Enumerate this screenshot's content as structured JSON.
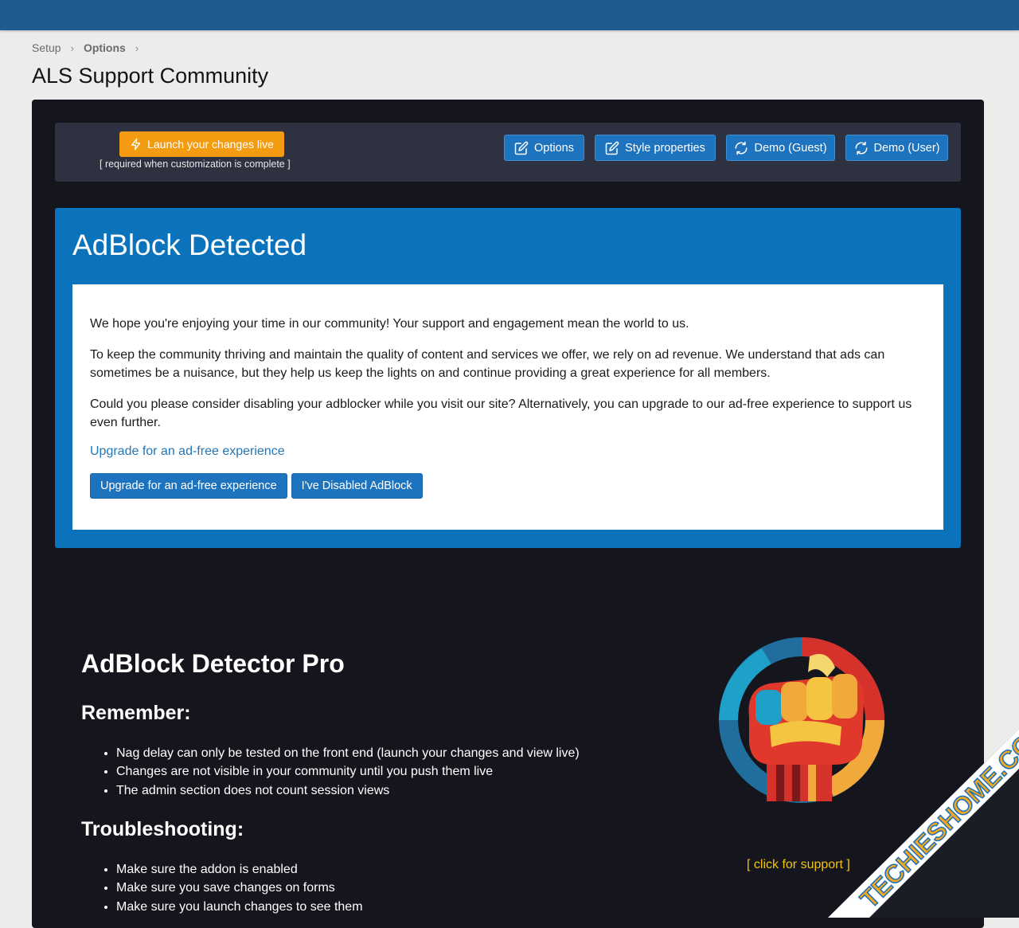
{
  "breadcrumb": {
    "items": [
      "Setup",
      "Options"
    ]
  },
  "page": {
    "title": "ALS Support Community"
  },
  "toolbar": {
    "launch_label": "Launch your changes live",
    "launch_note": "[ required when customization is complete ]",
    "buttons": [
      {
        "label": "Options",
        "icon": "edit-icon"
      },
      {
        "label": "Style properties",
        "icon": "edit-icon"
      },
      {
        "label": "Demo (Guest)",
        "icon": "refresh-icon"
      },
      {
        "label": "Demo (User)",
        "icon": "refresh-icon"
      }
    ]
  },
  "adblock": {
    "title": "AdBlock Detected",
    "paragraphs": [
      "We hope you're enjoying your time in our community! Your support and engagement mean the world to us.",
      "To keep the community thriving and maintain the quality of content and services we offer, we rely on ad revenue. We understand that ads can sometimes be a nuisance, but they help us keep the lights on and continue providing a great experience for all members.",
      "Could you please consider disabling your adblocker while you visit our site? Alternatively, you can upgrade to our ad-free experience to support us even further."
    ],
    "link_text": "Upgrade for an ad-free experience",
    "upgrade_button": "Upgrade for an ad-free experience",
    "disabled_button": "I've Disabled AdBlock"
  },
  "pro": {
    "title": "AdBlock Detector Pro",
    "remember_heading": "Remember:",
    "remember_items": [
      "Nag delay can only be tested on the front end (launch your changes and view live)",
      "Changes are not visible in your community until you push them live",
      "The admin section does not count session views"
    ],
    "troubleshooting_heading": "Troubleshooting:",
    "troubleshooting_items": [
      "Make sure the addon is enabled",
      "Make sure you save changes on forms",
      "Make sure you launch changes to see them"
    ],
    "support_link": "[ click for support ]"
  },
  "watermark": {
    "text": "TECHIESHOME.COM"
  },
  "colors": {
    "topbar": "#1e5b8f",
    "panel": "#15161d",
    "toolbar": "#2e3140",
    "launch": "#f39c12",
    "primary_button": "#1e73be",
    "adblock_box": "#0b73bc",
    "support_link": "#f1c40f"
  }
}
